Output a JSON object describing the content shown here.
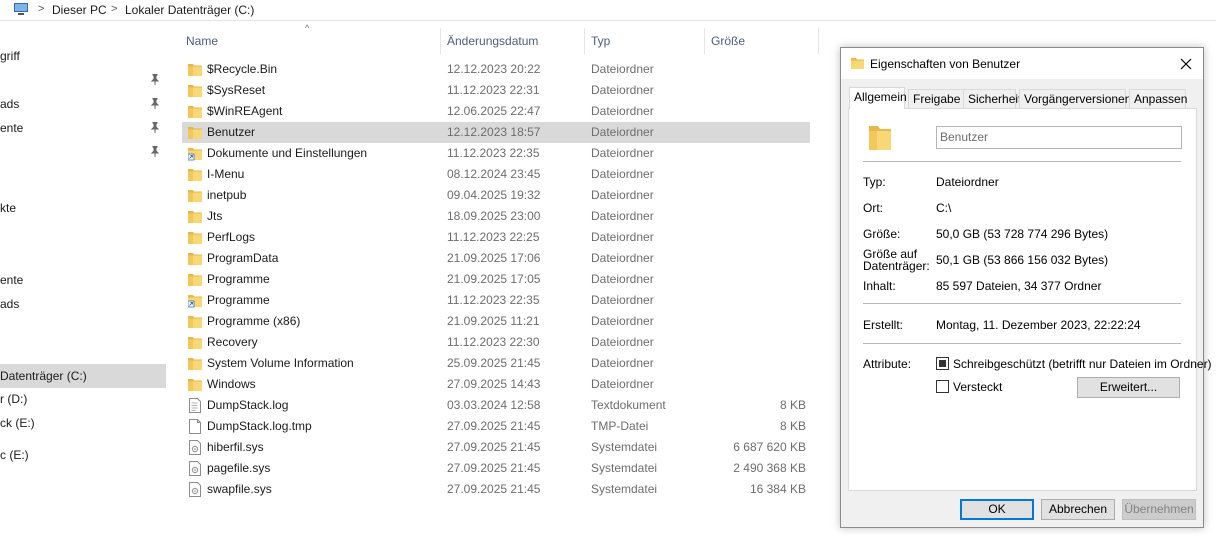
{
  "address_bar": {
    "crumbs": [
      "Dieser PC",
      "Lokaler Datenträger (C:)"
    ]
  },
  "nav_pane": {
    "items": [
      {
        "label": "griff",
        "pinned": false,
        "selected": false
      },
      {
        "label": "",
        "pinned": true,
        "selected": false
      },
      {
        "label": "ads",
        "pinned": true,
        "selected": false
      },
      {
        "label": "ente",
        "pinned": true,
        "selected": false
      },
      {
        "label": "",
        "pinned": true,
        "selected": false
      },
      {
        "label": "kte",
        "pinned": false,
        "selected": false
      },
      {
        "label": "ente",
        "pinned": false,
        "selected": false
      },
      {
        "label": "ads",
        "pinned": false,
        "selected": false
      },
      {
        "label": "Datenträger (C:)",
        "pinned": false,
        "selected": true
      },
      {
        "label": "r  (D:)",
        "pinned": false,
        "selected": false
      },
      {
        "label": "ck (E:)",
        "pinned": false,
        "selected": false
      },
      {
        "label": "c (E:)",
        "pinned": false,
        "selected": false
      }
    ]
  },
  "file_list": {
    "columns": {
      "name": "Name",
      "date": "Änderungsdatum",
      "type": "Typ",
      "size": "Größe"
    },
    "rows": [
      {
        "name": "$Recycle.Bin",
        "date": "12.12.2023 20:22",
        "type": "Dateiordner",
        "size": "",
        "icon": "folder-icon",
        "selected": false
      },
      {
        "name": "$SysReset",
        "date": "11.12.2023 22:31",
        "type": "Dateiordner",
        "size": "",
        "icon": "folder-icon",
        "selected": false
      },
      {
        "name": "$WinREAgent",
        "date": "12.06.2025 22:47",
        "type": "Dateiordner",
        "size": "",
        "icon": "folder-icon",
        "selected": false
      },
      {
        "name": "Benutzer",
        "date": "12.12.2023 18:57",
        "type": "Dateiordner",
        "size": "",
        "icon": "folder-icon",
        "selected": true
      },
      {
        "name": "Dokumente und Einstellungen",
        "date": "11.12.2023 22:35",
        "type": "Dateiordner",
        "size": "",
        "icon": "shortcut-folder-icon",
        "selected": false
      },
      {
        "name": "I-Menu",
        "date": "08.12.2024 23:45",
        "type": "Dateiordner",
        "size": "",
        "icon": "folder-icon",
        "selected": false
      },
      {
        "name": "inetpub",
        "date": "09.04.2025 19:32",
        "type": "Dateiordner",
        "size": "",
        "icon": "folder-icon",
        "selected": false
      },
      {
        "name": "Jts",
        "date": "18.09.2025 23:00",
        "type": "Dateiordner",
        "size": "",
        "icon": "folder-icon",
        "selected": false
      },
      {
        "name": "PerfLogs",
        "date": "11.12.2023 22:25",
        "type": "Dateiordner",
        "size": "",
        "icon": "folder-icon",
        "selected": false
      },
      {
        "name": "ProgramData",
        "date": "21.09.2025 17:06",
        "type": "Dateiordner",
        "size": "",
        "icon": "folder-icon",
        "selected": false
      },
      {
        "name": "Programme",
        "date": "21.09.2025 17:05",
        "type": "Dateiordner",
        "size": "",
        "icon": "folder-icon",
        "selected": false
      },
      {
        "name": "Programme",
        "date": "11.12.2023 22:35",
        "type": "Dateiordner",
        "size": "",
        "icon": "shortcut-folder-icon",
        "selected": false
      },
      {
        "name": "Programme (x86)",
        "date": "21.09.2025 11:21",
        "type": "Dateiordner",
        "size": "",
        "icon": "folder-icon",
        "selected": false
      },
      {
        "name": "Recovery",
        "date": "11.12.2023 22:30",
        "type": "Dateiordner",
        "size": "",
        "icon": "folder-icon",
        "selected": false
      },
      {
        "name": "System Volume Information",
        "date": "25.09.2025 21:45",
        "type": "Dateiordner",
        "size": "",
        "icon": "folder-icon",
        "selected": false
      },
      {
        "name": "Windows",
        "date": "27.09.2025 14:43",
        "type": "Dateiordner",
        "size": "",
        "icon": "folder-icon",
        "selected": false
      },
      {
        "name": "DumpStack.log",
        "date": "03.03.2024 12:58",
        "type": "Textdokument",
        "size": "8 KB",
        "icon": "text-file-icon",
        "selected": false
      },
      {
        "name": "DumpStack.log.tmp",
        "date": "27.09.2025 21:45",
        "type": "TMP-Datei",
        "size": "8 KB",
        "icon": "blank-file-icon",
        "selected": false
      },
      {
        "name": "hiberfil.sys",
        "date": "27.09.2025 21:45",
        "type": "Systemdatei",
        "size": "6 687 620 KB",
        "icon": "system-file-icon",
        "selected": false
      },
      {
        "name": "pagefile.sys",
        "date": "27.09.2025 21:45",
        "type": "Systemdatei",
        "size": "2 490 368 KB",
        "icon": "system-file-icon",
        "selected": false
      },
      {
        "name": "swapfile.sys",
        "date": "27.09.2025 21:45",
        "type": "Systemdatei",
        "size": "16 384 KB",
        "icon": "system-file-icon",
        "selected": false
      }
    ]
  },
  "dialog": {
    "title": "Eigenschaften von Benutzer",
    "tabs": [
      "Allgemein",
      "Freigabe",
      "Sicherheit",
      "Vorgängerversionen",
      "Anpassen"
    ],
    "active_tab": "Allgemein",
    "name_value": "Benutzer",
    "fields": {
      "type_label": "Typ:",
      "type_value": "Dateiordner",
      "location_label": "Ort:",
      "location_value": "C:\\",
      "size_label": "Größe:",
      "size_value": "50,0 GB (53 728 774 296 Bytes)",
      "disk_size_label_1": "Größe auf",
      "disk_size_label_2": "Datenträger:",
      "disk_size_value": "50,1 GB (53 866 156 032 Bytes)",
      "contents_label": "Inhalt:",
      "contents_value": "85 597 Dateien, 34 377 Ordner",
      "created_label": "Erstellt:",
      "created_value": "Montag, 11. Dezember 2023, 22:22:24",
      "attributes_label": "Attribute:"
    },
    "readonly_label": "Schreibgeschützt (betrifft nur Dateien im Ordner)",
    "readonly_state": "indeterminate",
    "hidden_label": "Versteckt",
    "hidden_checked": false,
    "advanced_button": "Erweitert...",
    "ok_button": "OK",
    "cancel_button": "Abbrechen",
    "apply_button": "Übernehmen",
    "apply_enabled": false
  },
  "colors": {
    "folder": "#f8d775",
    "folder_dark": "#e6b84a",
    "selection": "#d9d9d9",
    "header_text": "#4c607a",
    "accent": "#0078d7"
  }
}
